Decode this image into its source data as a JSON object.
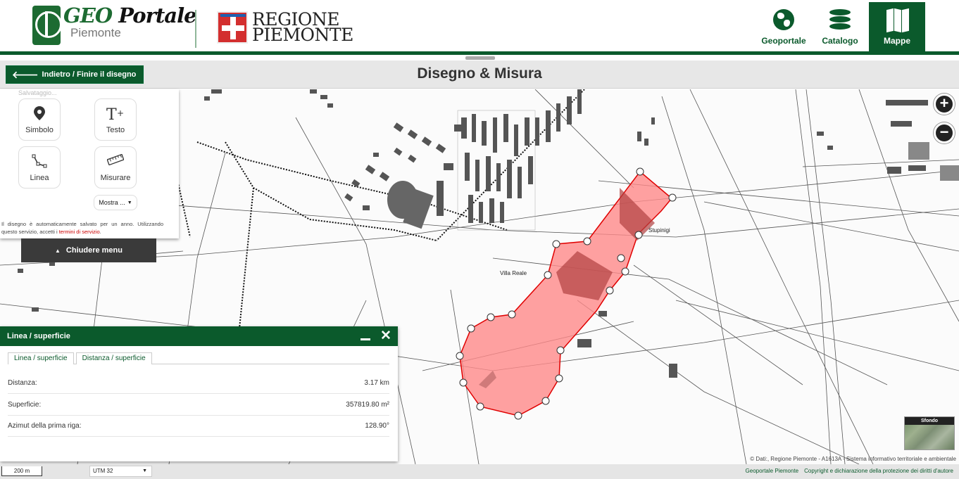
{
  "header": {
    "logo_title_a": "GEO",
    "logo_title_b": "Portale",
    "logo_subtitle": "Piemonte",
    "region_line1": "REGIONE",
    "region_line2": "PIEMONTE",
    "nav": [
      {
        "label": "Geoportale",
        "icon": "globe-icon"
      },
      {
        "label": "Catalogo",
        "icon": "database-icon"
      },
      {
        "label": "Mappe",
        "icon": "map-icon",
        "active": true
      }
    ]
  },
  "toolbar": {
    "back_label": "Indietro / Finire il disegno",
    "title": "Disegno & Misura"
  },
  "draw_panel": {
    "saving": "Salvataggio...",
    "tools": [
      {
        "label": "Simbolo",
        "icon": "pin-icon"
      },
      {
        "label": "Testo",
        "icon": "text-icon"
      },
      {
        "label": "Linea",
        "icon": "line-icon"
      },
      {
        "label": "Misurare",
        "icon": "ruler-icon"
      }
    ],
    "show_more": "Mostra ...",
    "notice_text": "Il disegno è automaticamente salvato per un anno. Utilizzando questo servizio, accetti i",
    "notice_link": "termini di servizio",
    "notice_end": ".",
    "close_menu": "Chiudere menu"
  },
  "map": {
    "labels": [
      "Stupinigi",
      "Villa Reale"
    ],
    "polygon_fill": "#ff8a8a",
    "polygon_stroke": "#e00000"
  },
  "measure_panel": {
    "title": "Linea / superficie",
    "tabs": [
      "Linea / superficie",
      "Distanza / superficie"
    ],
    "rows": [
      {
        "label": "Distanza:",
        "value": "3.17 km"
      },
      {
        "label": "Superficie:",
        "value": "357819.80 m²"
      },
      {
        "label": "Azimut della prima riga:",
        "value": "128.90°"
      }
    ]
  },
  "background_selector": "Sfondo",
  "attribution": "© Dati:, Regione Piemonte - A1613A - Sistema informativo territoriale e ambientale",
  "footer": {
    "scale": "200 m",
    "crs": "UTM 32",
    "links": [
      "Geoportale Piemonte",
      "Copyright e dichiarazione della protezione dei diritti d'autore"
    ]
  },
  "colors": {
    "brand_green": "#0b5a2c",
    "close_menu_bg": "#3a3a3a"
  }
}
